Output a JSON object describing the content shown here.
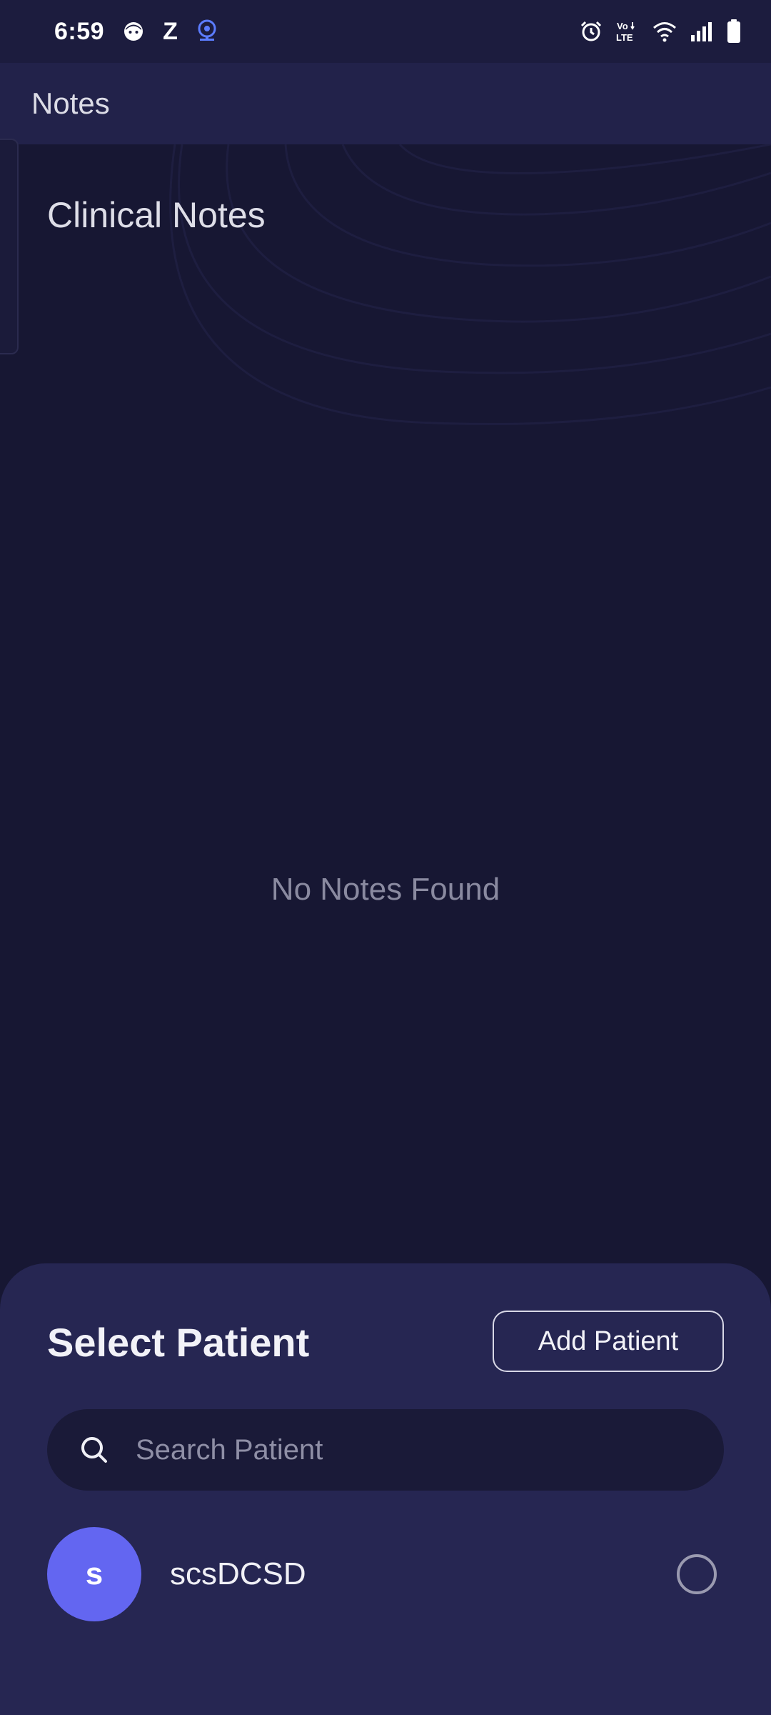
{
  "status_bar": {
    "time": "6:59",
    "left_icons": [
      "face-icon",
      "z-app-icon",
      "webcam-icon"
    ],
    "right_icons": [
      "alarm-icon",
      "volte-icon",
      "wifi-icon",
      "signal-icon",
      "battery-icon"
    ],
    "volte_top": "Vo",
    "volte_bottom": "LTE",
    "z_letter": "Z"
  },
  "app_bar": {
    "title": "Notes"
  },
  "main": {
    "section_title": "Clinical Notes",
    "empty_message": "No Notes Found"
  },
  "sheet": {
    "title": "Select Patient",
    "add_button": "Add Patient",
    "search_placeholder": "Search Patient",
    "patients": [
      {
        "initial": "s",
        "name": "scsDCSD",
        "selected": false
      }
    ]
  },
  "colors": {
    "background": "#171733",
    "app_bar": "#22224a",
    "sheet": "#262652",
    "search_bg": "#1a1a38",
    "avatar": "#6366f1",
    "muted_text": "#8a8aa0"
  }
}
